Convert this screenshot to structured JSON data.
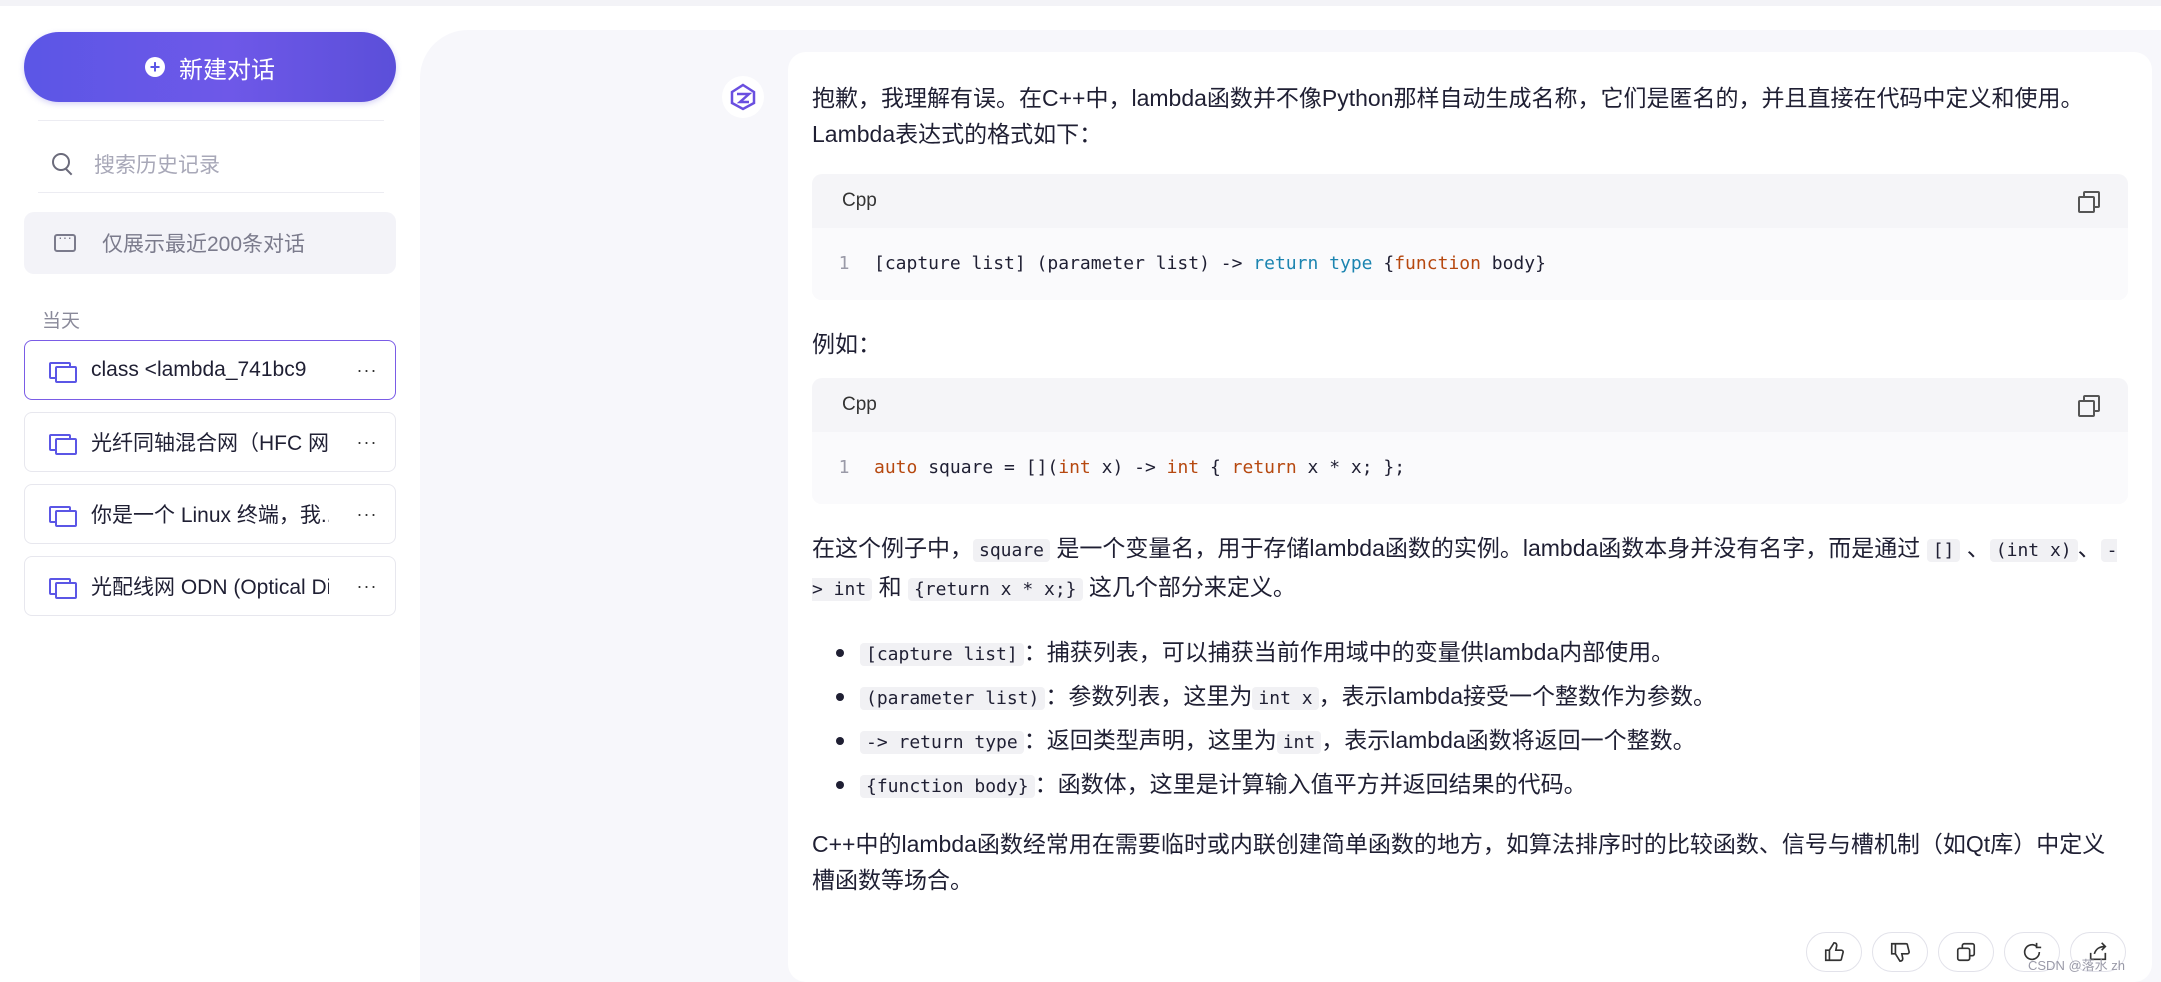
{
  "sidebar": {
    "new_chat_label": "新建对话",
    "search_placeholder": "搜索历史记录",
    "limit_notice": "仅展示最近200条对话",
    "section_today": "当天",
    "conversations": [
      {
        "title": "class <lambda_741bc9"
      },
      {
        "title": "光纤同轴混合网（HFC 网）"
      },
      {
        "title": "你是一个 Linux 终端，我..."
      },
      {
        "title": "光配线网 ODN (Optical Di"
      }
    ],
    "more_label": "···"
  },
  "message": {
    "intro": "抱歉，我理解有误。在C++中，lambda函数并不像Python那样自动生成名称，它们是匿名的，并且直接在代码中定义和使用。Lambda表达式的格式如下：",
    "code1": {
      "lang": "Cpp",
      "line_no": "1",
      "p1": "[capture list] (parameter list) -> ",
      "k1": "return",
      "s1": " ",
      "k2": "type",
      "p2": " {",
      "k3": "function",
      "p3": " body}"
    },
    "example_label": "例如：",
    "code2": {
      "lang": "Cpp",
      "line_no": "1",
      "k1": "auto",
      "p1": " square = [](",
      "k2": "int",
      "p2": " x) -> ",
      "k3": "int",
      "p3": " { ",
      "k4": "return",
      "p4": " x * x; };"
    },
    "explain": {
      "t1": "在这个例子中，",
      "c1": "square",
      "t2": " 是一个变量名，用于存储lambda函数的实例。lambda函数本身并没有名字，而是通过 ",
      "c2": "[]",
      "t3": " 、",
      "c3": "(int x)",
      "t4": "、",
      "c4": "-> int",
      "t5": " 和 ",
      "c5": "{return x * x;}",
      "t6": " 这几个部分来定义。"
    },
    "bullets": [
      {
        "code": "[capture list]",
        "text": "：捕获列表，可以捕获当前作用域中的变量供lambda内部使用。"
      },
      {
        "code": "(parameter list)",
        "text": "：参数列表，这里为",
        "code2": "int x",
        "text2": "，表示lambda接受一个整数作为参数。"
      },
      {
        "code": "-> return type",
        "text": "：返回类型声明，这里为",
        "code2": "int",
        "text2": "，表示lambda函数将返回一个整数。"
      },
      {
        "code": "{function body}",
        "text": "：函数体，这里是计算输入值平方并返回结果的代码。"
      }
    ],
    "outro": "C++中的lambda函数经常用在需要临时或内联创建简单函数的地方，如算法排序时的比较函数、信号与槽机制（如Qt库）中定义槽函数等场合。"
  },
  "watermark": "CSDN @落水 zh"
}
